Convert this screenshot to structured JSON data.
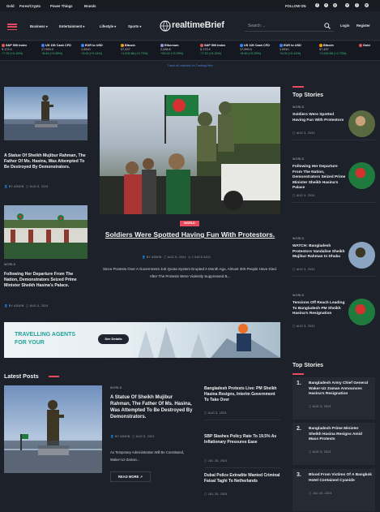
{
  "topbar": {
    "links": [
      "Gold",
      "Forex/Crypto",
      "Power Things",
      "Brands"
    ],
    "follow_label": "FOLLOW ON",
    "social": [
      "f",
      "t",
      "y",
      "v",
      "i",
      "p"
    ]
  },
  "header": {
    "nav": [
      "Business",
      "Entertainment",
      "Lifestyle",
      "Sports"
    ],
    "logo_prefix": "realtime",
    "logo_suffix": "Brief",
    "search_placeholder": "Search ...",
    "login": "Login",
    "register": "Register"
  },
  "ticker": [
    {
      "name": "S&P 500 Index",
      "value": "5,173.4",
      "change": "+7.32 (+0.15%)",
      "dir": "up",
      "color": "#e0584f"
    },
    {
      "name": "US 100 Cash CFD",
      "value": "17,999.4",
      "change": "+8.46 (+0.05%)",
      "dir": "up",
      "color": "#3b82f6"
    },
    {
      "name": "EUR to USD",
      "value": "1.0910",
      "change": "+0.00 (+0.14%)",
      "dir": "up",
      "color": "#3b82f6"
    },
    {
      "name": "Bitcoin",
      "value": "57,437",
      "change": "+1,532.86 (+2.73%)",
      "dir": "up",
      "color": "#f59e0b"
    },
    {
      "name": "Ethereum",
      "value": "2,438.8",
      "change": "+50.02 (+2.09%)",
      "dir": "up",
      "color": "#8b9be0"
    },
    {
      "name": "S&P 500 Index",
      "value": "5,173.4",
      "change": "+7.32 (+0.15%)",
      "dir": "up",
      "color": "#e0584f"
    },
    {
      "name": "US 100 Cash CFD",
      "value": "17,999.4",
      "change": "+8.46 (+0.05%)",
      "dir": "up",
      "color": "#3b82f6"
    },
    {
      "name": "EUR to USD",
      "value": "1.0910",
      "change": "+0.00 (+0.14%)",
      "dir": "up",
      "color": "#3b82f6"
    },
    {
      "name": "Bitcoin",
      "value": "57,437",
      "change": "+1,532.86 (+2.73%)",
      "dir": "up",
      "color": "#f59e0b"
    },
    {
      "name": "Gold",
      "value": "",
      "change": "",
      "dir": "up",
      "color": "#e0584f"
    }
  ],
  "ticker_note": "Track all markets on TradingView",
  "left_col": {
    "article1": {
      "title": "A Statue Of Sheikh Mujibur Rahman, The Father Of Ms. Hasina, Was Attempted To Be Destroyed By Demonstrators.",
      "author": "BY ADMIN",
      "date": "AUG 5, 2024"
    },
    "article2": {
      "category": "WORLD",
      "title": "Following Her Departure From The Nation, Demonstrators Seized Prime Minister Sheikh Hasina's Palace.",
      "author": "BY ADMIN",
      "date": "AUG 5, 2024"
    }
  },
  "hero": {
    "category": "WORLD",
    "title": "Soldiers Were Spotted Having Fun With Protestors.",
    "author": "BY ADMIN",
    "date": "AUG 5, 2024",
    "ago": "2 DAYS AGO",
    "excerpt": "Since Protests Over A Government Job Quota System Erupted A Month Ago, Almost 300 People Have Died. After The Protests Were Violently Suppressed B..."
  },
  "top_stories_a": {
    "heading": "Top Stories",
    "items": [
      {
        "category": "WORLD",
        "title": "Soldiers Were Spotted Having Fun With Protestors",
        "date": "AUG 5, 2024"
      },
      {
        "category": "WORLD",
        "title": "Following Her Departure From The Nation, Demonstrators Seized Prime Minister Sheikh Hasina's Palace",
        "date": "AUG 5, 2024"
      },
      {
        "category": "WORLD",
        "title": "WATCH: Bangladesh Protestors Vandalise Sheikh Mujibur Rahman In Dhaka",
        "date": "AUG 5, 2024"
      },
      {
        "category": "WORLD",
        "title": "Tensions Off Reach Leading To Bangladesh PM Sheikh Hasina's Resignation",
        "date": "AUG 5, 2024"
      }
    ]
  },
  "banner": {
    "headline_line1": "TRAVELLING AGENTS",
    "headline_line2": "FOR YOUR",
    "button": "See Details"
  },
  "latest": {
    "heading": "Latest Posts",
    "main": {
      "category": "WORLD",
      "title": "A Statue Of Sheikh Mujibur Rahman, The Father Of Ms. Hasina, Was Attempted To Be Destroyed By Demonstrators.",
      "author": "BY ADMIN",
      "date": "AUG 5, 2024",
      "excerpt": "An Temporary Administration Will Be Constituted, Waker-Uz-Zaman...",
      "read_more": "READ MORE"
    },
    "side": [
      {
        "title": "Bangladesh Protests Live: PM Sheikh Hasina Resigns, Interim Government To Take Over",
        "date": "AUG 5, 2024"
      },
      {
        "title": "SBP Slashes Policy Rate To 19.5% As Inflationary Pressures Ease",
        "date": "JUL 28, 2024"
      },
      {
        "title": "Dubai Police Extradite Wanted Criminal Faisal Taghi To Netherlands",
        "date": "JUL 29, 2024"
      }
    ]
  },
  "top_stories_b": {
    "heading": "Top Stories",
    "items": [
      {
        "num": "1.",
        "title": "Bangladesh Army Chief General Waker-Uz Zaman Announces Hasina's Resignation",
        "date": "AUG 5, 2024"
      },
      {
        "num": "2.",
        "title": "Bangladesh Prime Minister Sheikh Hasina Resigns Amid Mass Protests",
        "date": "AUG 5, 2024"
      },
      {
        "num": "3.",
        "title": "Blood From Victims Of A Bangkok Hotel Contained Cyanide",
        "date": "JUL 19, 2024"
      }
    ]
  },
  "colors": {
    "accent": "#e64a5c",
    "bg": "#1d2129",
    "card": "#252a33",
    "banner_bg": "#e9f2f6",
    "banner_text": "#22a398"
  }
}
